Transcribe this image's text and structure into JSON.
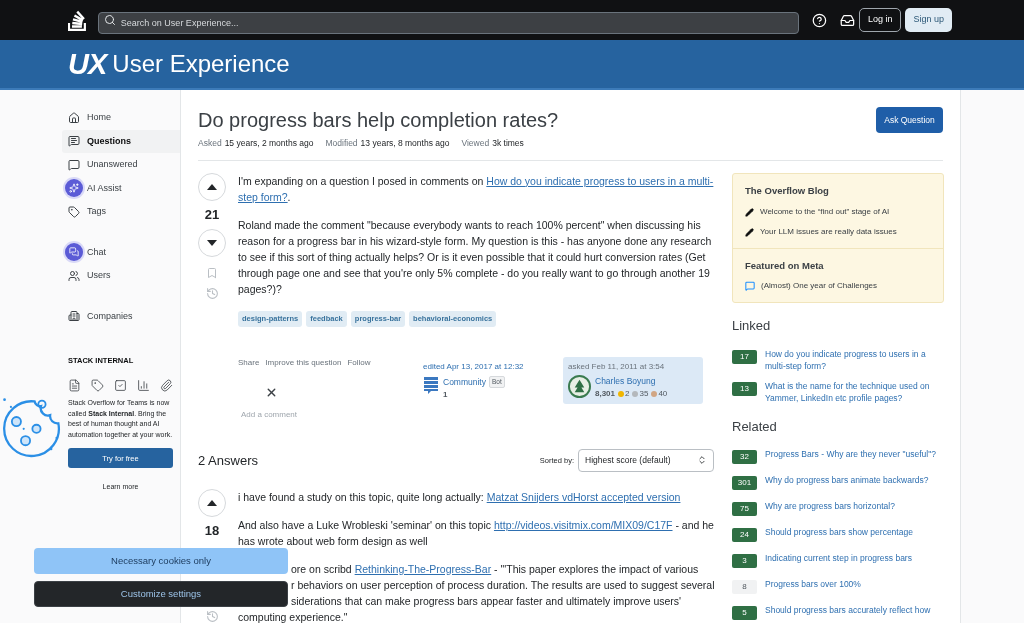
{
  "topbar": {
    "search": {
      "placeholder": "Search on User Experience..."
    },
    "buttons": [
      {
        "label": "Log in",
        "kind": "outline"
      },
      {
        "label": "Sign up",
        "kind": "filled"
      }
    ]
  },
  "site": {
    "logo_mark": "UX",
    "name": "User Experience"
  },
  "sidebar": {
    "groups": [
      [
        {
          "label": "Home",
          "selected": false,
          "highlighted": false
        },
        {
          "label": "Questions",
          "selected": true,
          "highlighted": false
        },
        {
          "label": "Unanswered",
          "selected": false,
          "highlighted": false
        },
        {
          "label": "AI Assist",
          "selected": false,
          "highlighted": true
        },
        {
          "label": "Tags",
          "selected": false,
          "highlighted": false
        }
      ],
      [
        {
          "label": "Chat",
          "selected": false,
          "highlighted": true
        },
        {
          "label": "Users",
          "selected": false,
          "highlighted": false
        }
      ],
      [
        {
          "label": "Companies",
          "selected": false,
          "highlighted": false
        }
      ]
    ],
    "section_title": "STACK INTERNAL",
    "promo": "Stack Overflow for Teams is now called **Stack Internal**. Bring the best of human thought and AI automation together at your work.",
    "promo_button": "Try for free",
    "promo_link": "Learn more"
  },
  "question": {
    "title": "Do progress bars help completion rates?",
    "ask_button": "Ask Question",
    "meta": [
      {
        "label": "Asked",
        "value": "15 years, 2 months ago"
      },
      {
        "label": "Modified",
        "value": "13 years, 8 months ago"
      },
      {
        "label": "Viewed",
        "value": "3k times"
      }
    ],
    "score": "21",
    "paragraphs": [
      [
        {
          "text": "I'm expanding on a question I posed in comments on "
        },
        {
          "link": "How do you indicate progress to users in a multi-"
        },
        {
          "link": "step form?"
        },
        {
          "text": "."
        }
      ],
      [
        {
          "text": "Roland made the comment \"because everybody wants to reach 100% percent\" when discussing his reason for a progress bar in his wizard-style form. My question is this - has anyone done any research to see if this sort of thing actually helps? Or is it even possible that it could hurt conversion rates (Get through page one and see that you're only 5% complete - do you really want to go through another 19 pages?)?"
        }
      ]
    ],
    "tags": [
      "design-patterns",
      "feedback",
      "progress-bar",
      "behavioral-economics"
    ],
    "actions": [
      "Share",
      "Improve this question",
      "Follow"
    ],
    "edited": {
      "label": "edited Apr 13, 2017 at 12:32",
      "user": "Community",
      "badge": "Bot",
      "reputation": "1"
    },
    "asked": {
      "label": "asked Feb 11, 2011 at 3:54",
      "user": "Charles Boyung",
      "reputation": "8,301",
      "badges": [
        {
          "count": "2",
          "color": "#f1b600"
        },
        {
          "count": "35",
          "color": "#b4b8bc"
        },
        {
          "count": "40",
          "color": "#d1a684"
        }
      ]
    },
    "add_comment": "Add a comment"
  },
  "answers": {
    "heading": "2 Answers",
    "sort_label": "Sorted by:",
    "sort_value": "Highest score (default)",
    "items": [
      {
        "score": "18",
        "paragraphs": [
          [
            {
              "text": "i have found a study on this topic, quite long actually: "
            },
            {
              "link": "Matzat Snijders vdHorst accepted version"
            }
          ],
          [
            {
              "text": "And also have a Luke Wrobleski 'seminar' on this topic "
            },
            {
              "link": "http://videos.visitmix.com/MIX09/C17F"
            },
            {
              "text": " - and he has wrote about web form design as well"
            }
          ]
        ],
        "covered_lines": [
          [
            {
              "text": "ore on scribd "
            },
            {
              "link": "Rethinking-The-Progress-Bar"
            },
            {
              "text": " - \"'This paper explores the impact of various"
            }
          ],
          [
            {
              "text": "r behaviors on user perception of process duration. The results are used to suggest several"
            }
          ],
          [
            {
              "text": "siderations that can make progress bars appear faster and ultimately improve users'"
            }
          ]
        ],
        "tail": "computing experience.\""
      }
    ]
  },
  "right": {
    "blog": {
      "title": "The Overflow Blog",
      "items": [
        "Welcome to the “find out” stage of AI",
        "Your LLM issues are really data issues"
      ]
    },
    "featured": {
      "title": "Featured on Meta",
      "items": [
        "(Almost) One year of Challenges"
      ]
    },
    "linked": {
      "title": "Linked",
      "items": [
        {
          "score": "17",
          "accepted": true,
          "title": "How do you indicate progress to users in a multi-step form?"
        },
        {
          "score": "13",
          "accepted": true,
          "title": "What is the name for the technique used on Yammer, LinkedIn etc profile pages?"
        }
      ]
    },
    "related": {
      "title": "Related",
      "items": [
        {
          "score": "32",
          "accepted": true,
          "title": "Progress Bars - Why are they never \"useful\"?"
        },
        {
          "score": "301",
          "accepted": true,
          "title": "Why do progress bars animate backwards?"
        },
        {
          "score": "75",
          "accepted": true,
          "title": "Why are progress bars horizontal?"
        },
        {
          "score": "24",
          "accepted": true,
          "title": "Should progress bars show percentage"
        },
        {
          "score": "3",
          "accepted": true,
          "title": "Indicating current step in progress bars"
        },
        {
          "score": "8",
          "accepted": false,
          "title": "Progress bars over 100%"
        },
        {
          "score": "5",
          "accepted": true,
          "title": "Should progress bars accurately reflect how"
        }
      ]
    }
  },
  "cookie": {
    "buttons": [
      {
        "label": "Necessary cookies only",
        "kind": "primary"
      },
      {
        "label": "Customize settings",
        "kind": "dark"
      }
    ]
  }
}
